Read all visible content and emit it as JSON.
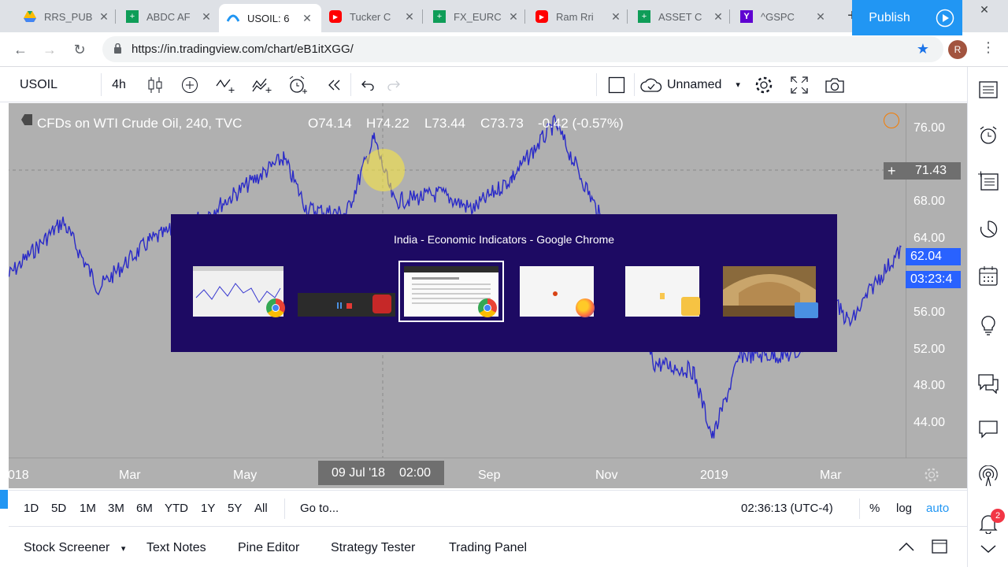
{
  "browser": {
    "tabs": [
      {
        "title": "RRS_PUB",
        "icon": "google-drive-icon",
        "color": "#1fa463"
      },
      {
        "title": "ABDC AF",
        "icon": "google-sheets-icon",
        "color": "#0f9d58"
      },
      {
        "title": "USOIL: 6",
        "icon": "tradingview-icon",
        "color": "#2196f3"
      },
      {
        "title": "Tucker C",
        "icon": "youtube-icon",
        "color": "#ff0000"
      },
      {
        "title": "FX_EURC",
        "icon": "google-sheets-icon",
        "color": "#0f9d58"
      },
      {
        "title": "Ram Rri",
        "icon": "youtube-icon",
        "color": "#ff0000"
      },
      {
        "title": "ASSET C",
        "icon": "google-sheets-icon",
        "color": "#0f9d58"
      },
      {
        "title": "^GSPC",
        "icon": "yahoo-icon",
        "color": "#5f01d1"
      }
    ],
    "url": "https://in.tradingview.com/chart/eB1itXGG/",
    "profile_initial": "R"
  },
  "toolbar": {
    "symbol": "USOIL",
    "interval": "4h",
    "layout_name": "Unnamed",
    "publish_label": "Publish"
  },
  "chart": {
    "legend_title": "CFDs on WTI Crude Oil, 240, TVC",
    "open": "O74.14",
    "high": "H74.22",
    "low": "L73.44",
    "close": "C73.73",
    "change": "-0.42 (-0.57%)",
    "price_ticks": [
      "76.00",
      "68.00",
      "64.00",
      "56.00",
      "52.00",
      "48.00",
      "44.00"
    ],
    "time_ticks": [
      "018",
      "Mar",
      "May",
      "Sep",
      "Nov",
      "2019",
      "Mar"
    ],
    "crosshair_price": "71.43",
    "crosshair_time_date": "09 Jul '18",
    "crosshair_time_hour": "02:00",
    "last_price": "62.04",
    "countdown": "03:23:4",
    "line_color": "#2a2ac8"
  },
  "alttab": {
    "title": "India - Economic Indicators - Google Chrome"
  },
  "range": {
    "buttons": [
      "1D",
      "5D",
      "1M",
      "3M",
      "6M",
      "YTD",
      "1Y",
      "5Y",
      "All"
    ],
    "goto": "Go to...",
    "clock": "02:36:13 (UTC-4)",
    "percent": "%",
    "log": "log",
    "auto": "auto"
  },
  "panels": {
    "stock_screener": "Stock Screener",
    "text_notes": "Text Notes",
    "pine_editor": "Pine Editor",
    "strategy_tester": "Strategy Tester",
    "trading_panel": "Trading Panel"
  },
  "notifications_count": "2"
}
